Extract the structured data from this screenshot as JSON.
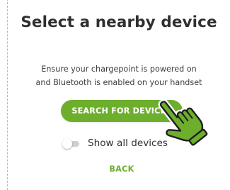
{
  "dialog": {
    "title": "Select a nearby device",
    "description_line1": "Ensure your chargepoint is powered on",
    "description_line2": "and Bluetooth is enabled on your handset"
  },
  "actions": {
    "search_label": "SEARCH FOR DEVICES",
    "show_all_label": "Show all devices",
    "show_all_enabled": false,
    "back_label": "BACK"
  },
  "icons": {
    "pointer": "hand-pointer-icon"
  },
  "colors": {
    "accent": "#6daf2c",
    "title_text": "#2f2f2f",
    "body_text": "#3c3c3c",
    "toggle_track": "#cfcfcf",
    "frame_border": "#b9b9b9"
  }
}
